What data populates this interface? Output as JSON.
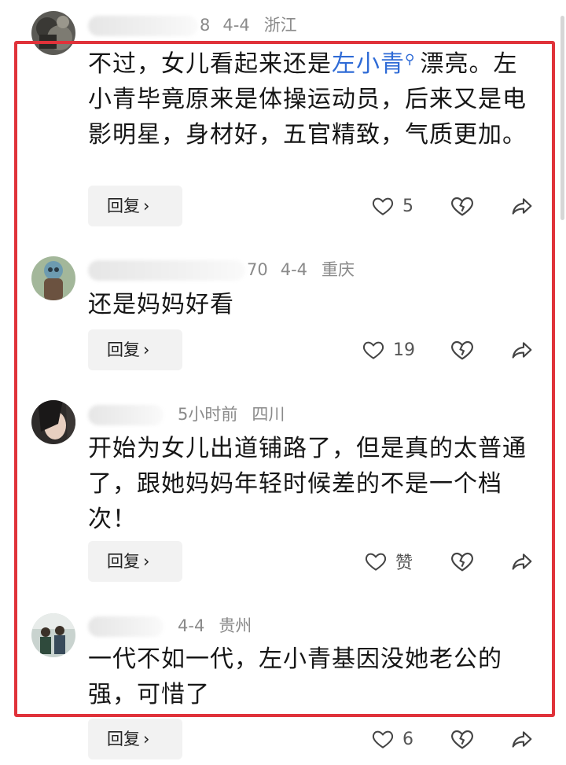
{
  "comments": [
    {
      "meta_tail": "8",
      "date": "4-4",
      "location": "浙江",
      "text_before": "不过，女儿看起来还是",
      "link": "左小青",
      "text_after": "漂亮。左小青毕竟原来是体操运动员，后来又是电影明星，身材好，五官精致，气质更加。",
      "reply_label": "回复",
      "likes": "5"
    },
    {
      "meta_tail": "70",
      "date": "4-4",
      "location": "重庆",
      "text": "还是妈妈好看",
      "reply_label": "回复",
      "likes": "19"
    },
    {
      "date": "5小时前",
      "location": "四川",
      "text": "开始为女儿出道铺路了，但是真的太普通了，跟她妈妈年轻时候差的不是一个档次！",
      "reply_label": "回复",
      "likes": "赞"
    },
    {
      "date": "4-4",
      "location": "贵州",
      "text": "一代不如一代，左小青基因没她老公的强，可惜了",
      "reply_label": "回复",
      "likes": "6"
    }
  ],
  "colors": {
    "highlight_frame": "#e0323a",
    "link": "#2f6bd6",
    "meta_text": "#8a8a8a",
    "reply_bg": "#f2f2f2"
  },
  "icons": {
    "like": "heart-outline-icon",
    "dislike": "broken-heart-icon",
    "share": "share-arrow-icon",
    "reply_chevron": "chevron-right-icon",
    "search_mark": "search-icon"
  }
}
